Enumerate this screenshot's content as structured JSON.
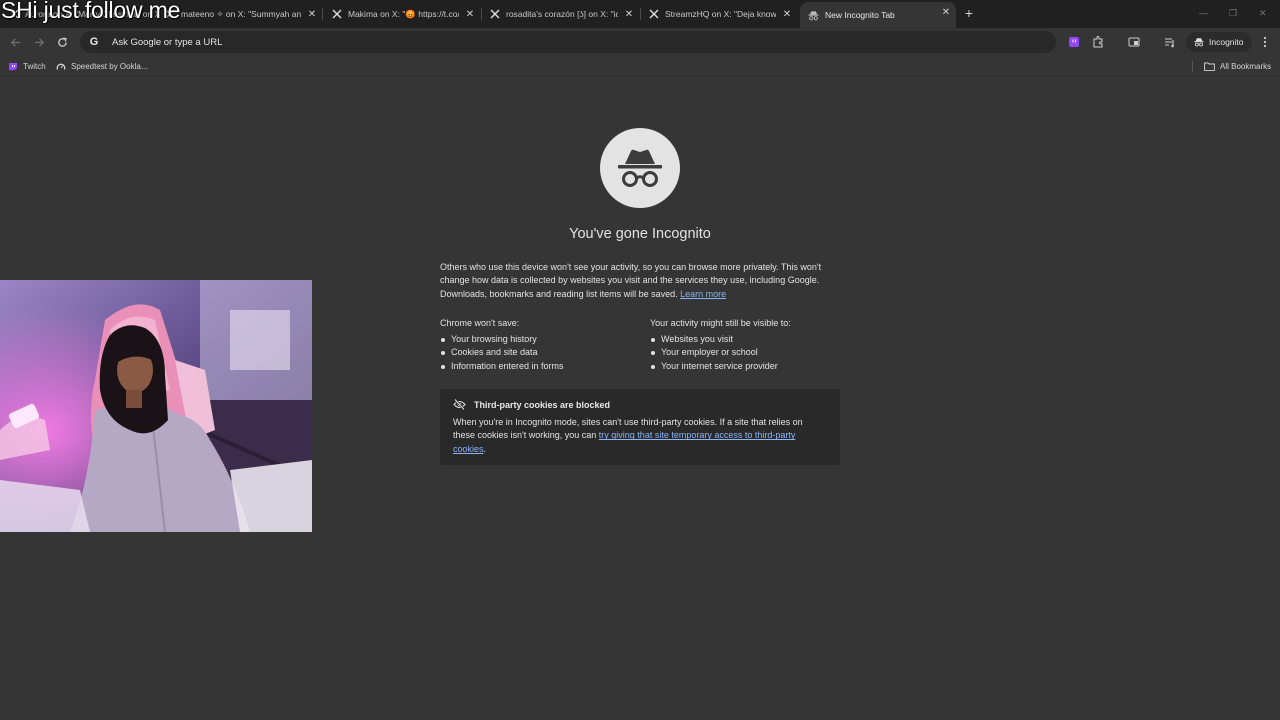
{
  "overlay": {
    "caption": "SHi just follow me"
  },
  "tabs": [
    {
      "title": "Aurora on X: \"Marry Christmas on X\"",
      "icon": "x-icon"
    },
    {
      "title": "mateeno ✧ on X: \"Summyah and",
      "icon": "x-icon"
    },
    {
      "title": "Makima on X: \"😡 https://t.co/",
      "icon": "x-icon"
    },
    {
      "title": "rosadita's corazón [ʖ] on X: \"ice",
      "icon": "x-icon"
    },
    {
      "title": "StreamzHQ on X: \"Deja knows e",
      "icon": "x-icon"
    },
    {
      "title": "New Incognito Tab",
      "icon": "incognito-icon",
      "active": true
    }
  ],
  "toolbar": {
    "omnibox_placeholder": "Ask Google or type a URL",
    "profile_label": "Incognito"
  },
  "bookmarks": {
    "items": [
      {
        "label": "Twitch",
        "icon": "twitch-icon"
      },
      {
        "label": "Speedtest by Ookla...",
        "icon": "speedtest-icon"
      }
    ],
    "all_bookmarks_label": "All Bookmarks"
  },
  "main": {
    "heading": "You've gone Incognito",
    "intro": "Others who use this device won't see your activity, so you can browse more privately. This won't change how data is collected by websites you visit and the services they use, including Google. Downloads, bookmarks and reading list items will be saved.",
    "learn_more": "Learn more",
    "wont_save": {
      "title_prefix": "Chrome ",
      "title_bold": "won't save:",
      "items": [
        "Your browsing history",
        "Cookies and site data",
        "Information entered in forms"
      ]
    },
    "might_be_visible": {
      "title_prefix": "Your activity ",
      "title_bold": "might still be visible",
      "title_suffix": " to:",
      "items": [
        "Websites you visit",
        "Your employer or school",
        "Your internet service provider"
      ]
    },
    "cookie_card": {
      "title": "Third-party cookies are blocked",
      "body": "When you're in Incognito mode, sites can't use third-party cookies. If a site that relies on these cookies isn't working, you can ",
      "link": "try giving that site temporary access to third-party cookies",
      "end": "."
    }
  },
  "colors": {
    "background": "#353535",
    "link": "#8ab4f8",
    "card": "#292929"
  }
}
